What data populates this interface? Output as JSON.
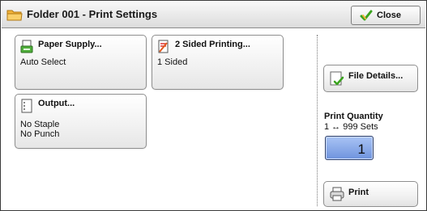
{
  "window": {
    "title": "Folder 001 - Print Settings"
  },
  "header": {
    "close_label": "Close"
  },
  "features": {
    "paper_supply": {
      "name": "Paper Supply...",
      "value": "Auto Select"
    },
    "two_sided": {
      "name": "2 Sided Printing...",
      "value": "1 Sided"
    },
    "output": {
      "name": "Output...",
      "values": [
        "No Staple",
        "No Punch"
      ]
    }
  },
  "side": {
    "file_details_label": "File Details...",
    "print_quantity_title": "Print Quantity",
    "print_quantity_range": "1 ↔ 999 Sets",
    "print_quantity_value": "1",
    "print_label": "Print"
  },
  "icons": {
    "title": "folder-icon",
    "close": "checkmark-icon",
    "paper_supply": "paper-tray-icon",
    "two_sided": "duplex-page-icon",
    "output": "output-page-icon",
    "file_details": "file-details-icon",
    "print": "printer-icon"
  },
  "colors": {
    "accent_check": "#3aa31e",
    "folder": "#f2b33a",
    "quantity_field": "#8fb0ee",
    "titlebar": "#e6e6e6"
  }
}
